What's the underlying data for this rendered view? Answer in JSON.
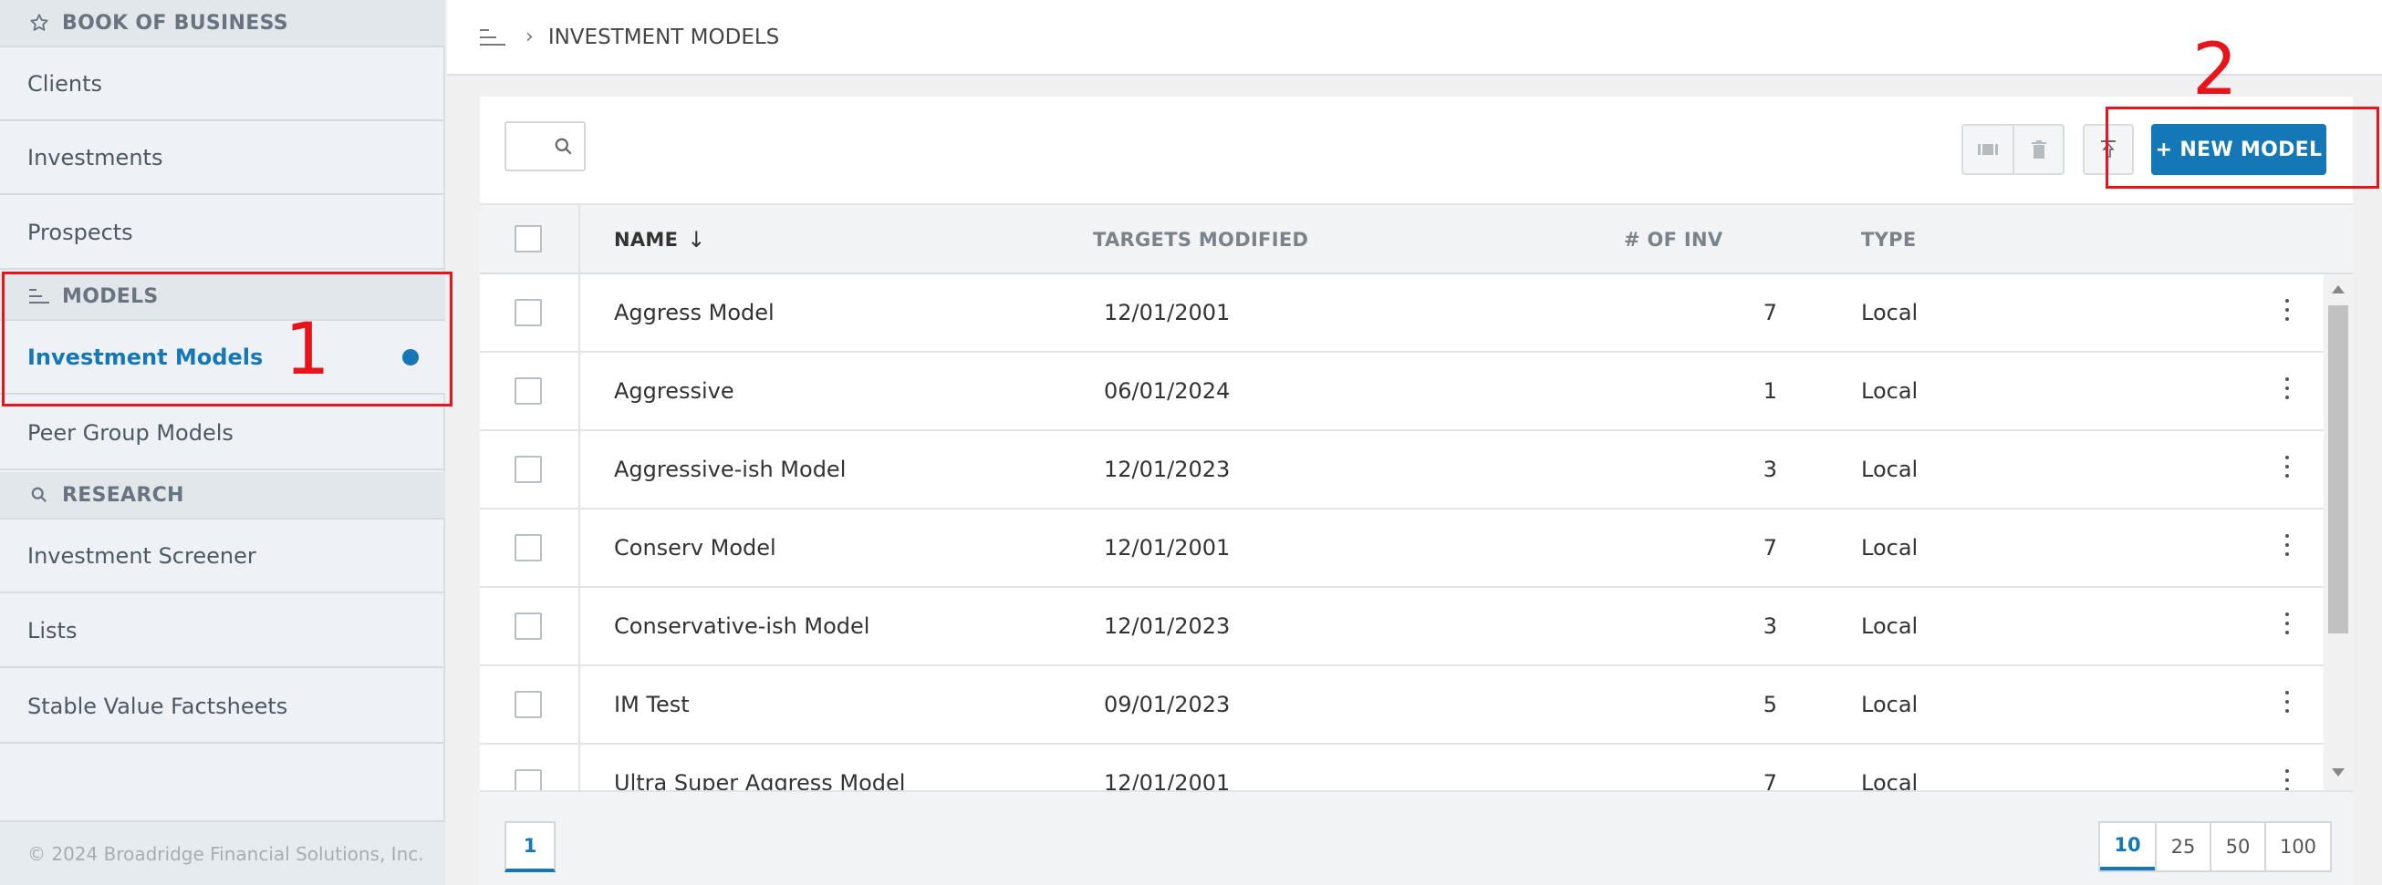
{
  "sidebar": {
    "book_header": "BOOK OF BUSINESS",
    "book_items": [
      {
        "label": "Clients"
      },
      {
        "label": "Investments"
      },
      {
        "label": "Prospects"
      }
    ],
    "models_header": "MODELS",
    "models_items": [
      {
        "label": "Investment Models",
        "active": true
      },
      {
        "label": "Peer Group Models"
      }
    ],
    "research_header": "RESEARCH",
    "research_items": [
      {
        "label": "Investment Screener"
      },
      {
        "label": "Lists"
      },
      {
        "label": "Stable Value Factsheets"
      }
    ],
    "copyright": "© 2024 Broadridge Financial Solutions, Inc."
  },
  "topbar": {
    "breadcrumb": "INVESTMENT MODELS"
  },
  "toolbar": {
    "new_model_label": "+ NEW MODEL"
  },
  "table": {
    "columns": {
      "name": "NAME",
      "sort_indicator": "↓",
      "targets": "TARGETS MODIFIED",
      "inv": "# OF INV",
      "type": "TYPE"
    },
    "rows": [
      {
        "name": "Aggress Model",
        "targets": "12/01/2001",
        "inv": "7",
        "type": "Local"
      },
      {
        "name": "Aggressive",
        "targets": "06/01/2024",
        "inv": "1",
        "type": "Local"
      },
      {
        "name": "Aggressive-ish Model",
        "targets": "12/01/2023",
        "inv": "3",
        "type": "Local"
      },
      {
        "name": "Conserv Model",
        "targets": "12/01/2001",
        "inv": "7",
        "type": "Local"
      },
      {
        "name": "Conservative-ish Model",
        "targets": "12/01/2023",
        "inv": "3",
        "type": "Local"
      },
      {
        "name": "IM Test",
        "targets": "09/01/2023",
        "inv": "5",
        "type": "Local"
      },
      {
        "name": "Ultra Super Aggress Model",
        "targets": "12/01/2001",
        "inv": "7",
        "type": "Local"
      }
    ]
  },
  "pagination": {
    "current_page": "1",
    "page_sizes": [
      "10",
      "25",
      "50",
      "100"
    ]
  },
  "annotations": {
    "one": "1",
    "two": "2"
  },
  "colors": {
    "accent": "#1477b6",
    "annotation": "#e8141b"
  }
}
